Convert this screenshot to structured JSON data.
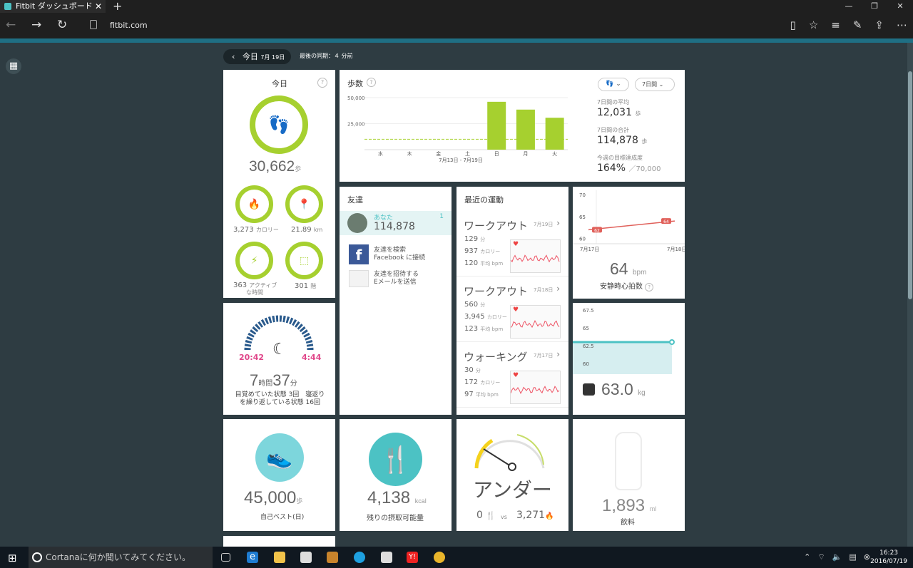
{
  "browser": {
    "tab_title": "Fitbit ダッシュボード",
    "url": "fitbit.com"
  },
  "header": {
    "date_label": "今日",
    "date_small": "7月 19日",
    "last_sync": "最後の同期：４ 分前"
  },
  "today": {
    "title": "今日",
    "steps": "30,662",
    "steps_unit": "歩",
    "calories": "3,273",
    "calories_unit": "カロリー",
    "distance": "21.89",
    "distance_unit": "km",
    "active_minutes": "363",
    "active_unit_line1": "アクティブ",
    "active_unit_line2": "な時間",
    "floors": "301",
    "floors_unit": "階"
  },
  "steps_card": {
    "title": "歩数",
    "chart_data": {
      "type": "bar",
      "categories": [
        "水",
        "木",
        "金",
        "土",
        "日",
        "月",
        "火"
      ],
      "values": [
        0,
        0,
        0,
        0,
        46000,
        38500,
        30662
      ],
      "ylim": [
        0,
        50000
      ],
      "yticks": [
        "50,000",
        "25,000"
      ],
      "goal": 10000,
      "xlabel": "7月13日 - 7月19日"
    },
    "dropdown_period": "7日間",
    "avg_label": "7日間の平均",
    "avg_value": "12,031",
    "total_label": "7日間の合計",
    "total_value": "114,878",
    "unit": "歩",
    "goal_label": "今週の目標達成度",
    "goal_pct": "164%",
    "goal_target": "／70,000"
  },
  "friends": {
    "title": "友達",
    "you_label": "あなた",
    "you_steps": "114,878",
    "you_rank": "1",
    "fb_line1": "友達を検索",
    "fb_line2": "Facebook に接続",
    "mail_line1": "友達を招待する",
    "mail_line2": "Eメールを送信"
  },
  "exercise": {
    "title": "最近の運動",
    "items": [
      {
        "name": "ワークアウト",
        "date": "7月19日",
        "minutes": "129",
        "calories": "937",
        "bpm": "120"
      },
      {
        "name": "ワークアウト",
        "date": "7月18日",
        "minutes": "560",
        "calories": "3,945",
        "bpm": "123"
      },
      {
        "name": "ウォーキング",
        "date": "7月17日",
        "minutes": "30",
        "calories": "172",
        "bpm": "97"
      }
    ],
    "min_unit": "分",
    "cal_unit": "カロリー",
    "bpm_unit": "平均 bpm"
  },
  "heart": {
    "chart_data": {
      "type": "line",
      "x": [
        "7月17日",
        "7月18日"
      ],
      "values": [
        62,
        64
      ],
      "yticks": [
        "70",
        "65",
        "60"
      ],
      "ylim": [
        58,
        71
      ]
    },
    "value": "64",
    "unit": "bpm",
    "label": "安静時心拍数"
  },
  "sleep": {
    "start": "20:42",
    "end": "4:44",
    "hours": "7",
    "hours_unit": "時間",
    "minutes": "37",
    "minutes_unit": "分",
    "detail_line1": "目覚めていた状態 3回　寝返り",
    "detail_line2": "を繰り返している状態 16回"
  },
  "weight": {
    "chart_data": {
      "type": "line",
      "yticks": [
        "67.5",
        "65",
        "62.5",
        "60"
      ],
      "values": [
        63.0
      ],
      "ylim": [
        59,
        68
      ]
    },
    "value": "63.0",
    "unit": "kg"
  },
  "best": {
    "value": "45,000",
    "unit": "歩",
    "label": "自己ベスト(日)"
  },
  "food": {
    "value": "4,138",
    "unit": "kcal",
    "label": "残りの摂取可能量"
  },
  "balance": {
    "status": "アンダー",
    "in": "0",
    "vs": "vs",
    "out": "3,271"
  },
  "water": {
    "value": "1,893",
    "unit": "ml",
    "label": "飲料"
  },
  "taskbar": {
    "cortana": "Cortanaに何か聞いてみてください。",
    "time": "16:23",
    "date": "2016/07/19"
  }
}
